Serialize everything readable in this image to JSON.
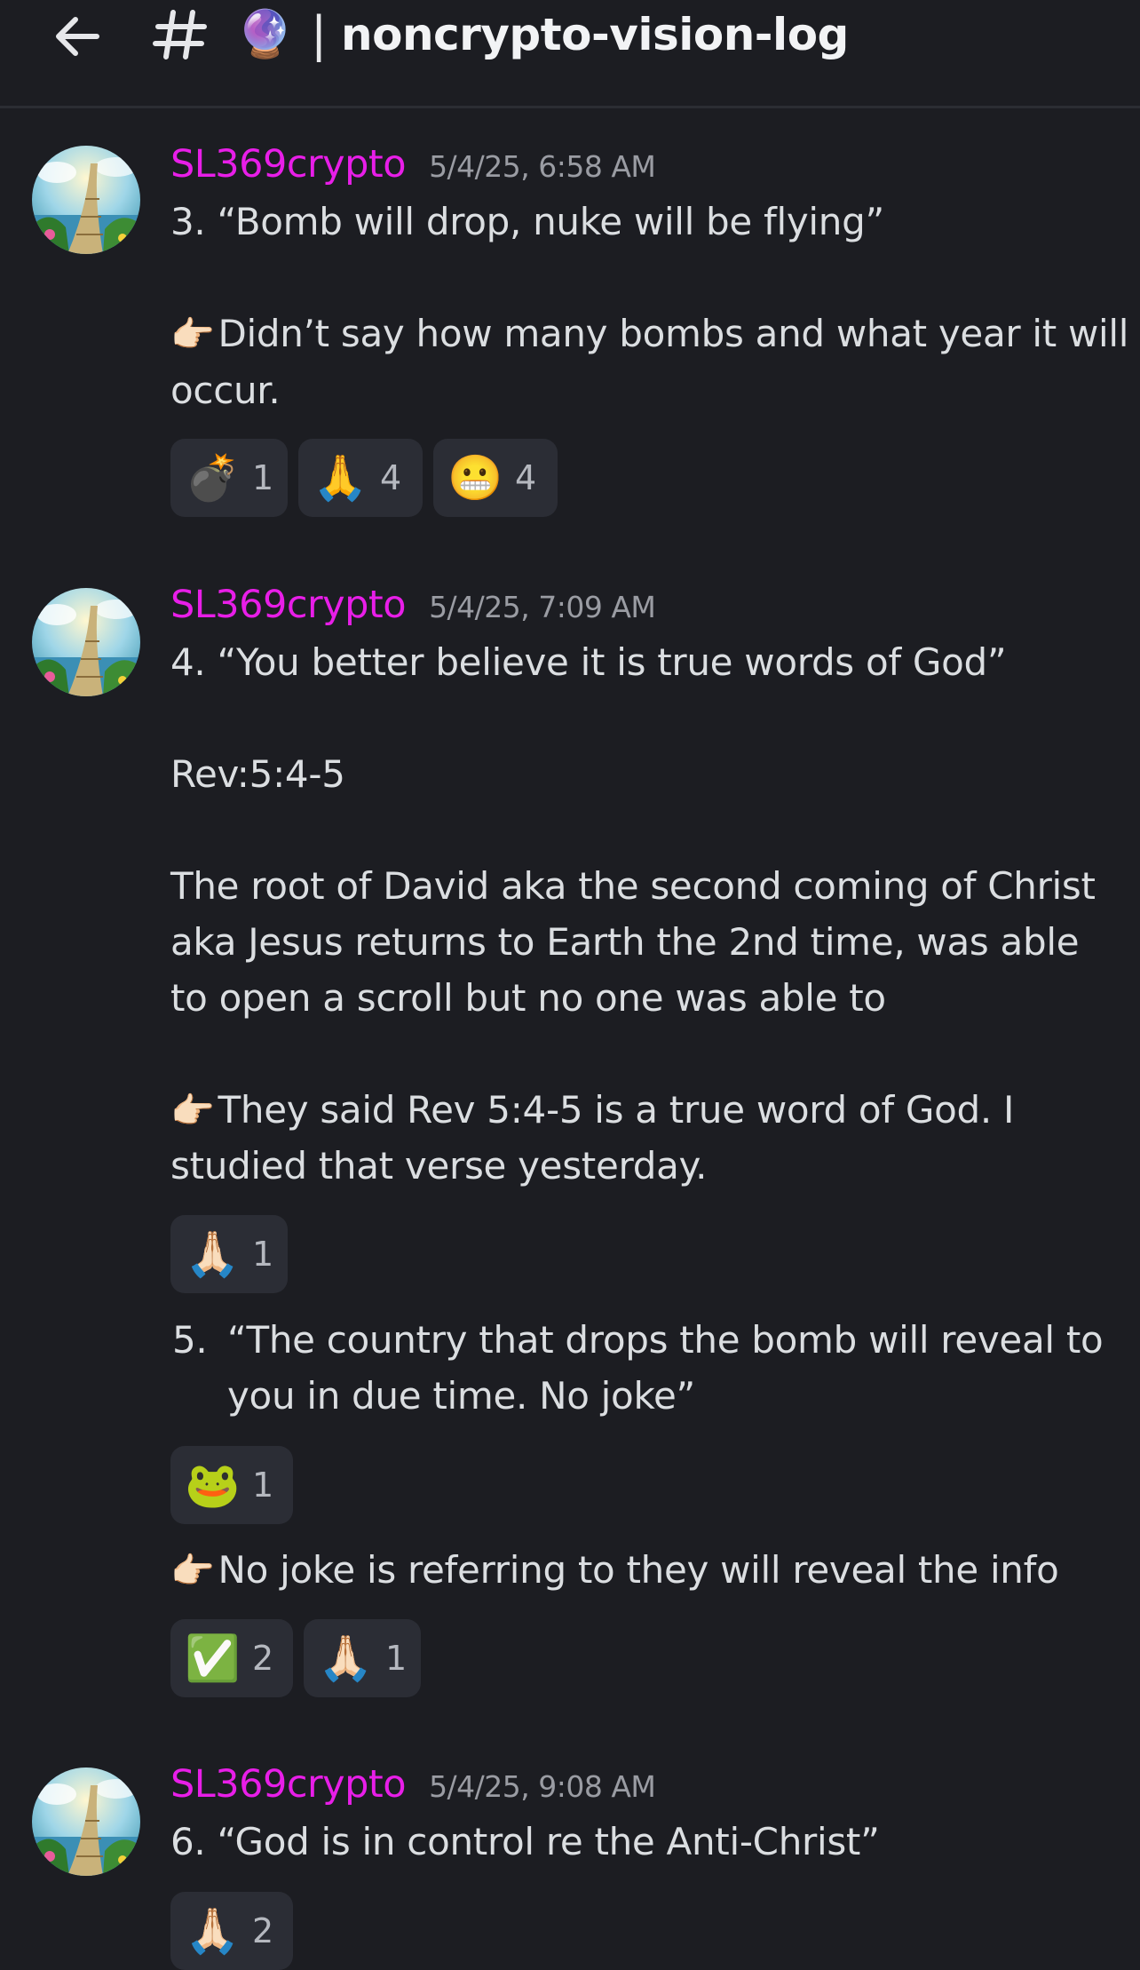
{
  "header": {
    "back_icon": "arrow-left-icon",
    "hash_icon": "hash-icon",
    "channel_emoji": "🔮",
    "separator": "|",
    "channel_name": "noncrypto-vision-log"
  },
  "colors": {
    "background": "#1c1d22",
    "username": "#e81ee8",
    "timestamp": "#9a9ca3",
    "reaction_bg": "#2b2d35"
  },
  "messages": [
    {
      "author": "SL369crypto",
      "timestamp": "5/4/25, 6:58 AM",
      "lines": [
        "3.  “Bomb will drop, nuke will be flying”",
        "Didn’t say how many bombs and what year it will",
        "occur."
      ],
      "pointer_emoji": "👉🏻",
      "reactions": [
        {
          "emoji": "💣",
          "count": "1"
        },
        {
          "emoji": "🙏",
          "count": "4"
        },
        {
          "emoji": "😬",
          "count": "4"
        }
      ]
    },
    {
      "author": "SL369crypto",
      "timestamp": "5/4/25, 7:09 AM",
      "lines": [
        "4.  “You better believe it is true words of God”",
        "Rev:5:4-5",
        "The root of David aka the second coming of Christ",
        "aka Jesus returns to Earth the 2nd time, was able",
        "to open a scroll but no one was able to",
        "They said Rev 5:4-5 is a true word of God. I",
        "studied that verse yesterday."
      ],
      "pointer_emoji": "👉🏻",
      "reactions": [
        {
          "emoji": "🙏🏻",
          "count": "1"
        }
      ]
    },
    {
      "lines": [
        "5.",
        "“The country that drops the bomb will reveal to",
        "you in due time. No joke”"
      ],
      "reactions": [
        {
          "emoji": "🐸",
          "count": "1"
        }
      ]
    },
    {
      "pointer_emoji": "👉🏻",
      "lines": [
        "No joke is referring to they will reveal the info"
      ],
      "reactions": [
        {
          "emoji": "✅",
          "count": "2"
        },
        {
          "emoji": "🙏🏻",
          "count": "1"
        }
      ]
    },
    {
      "author": "SL369crypto",
      "timestamp": "5/4/25, 9:08 AM",
      "lines": [
        "6.  “God is in control re the Anti-Christ”"
      ],
      "reactions": [
        {
          "emoji": "🙏🏻",
          "count": "2"
        }
      ]
    }
  ]
}
